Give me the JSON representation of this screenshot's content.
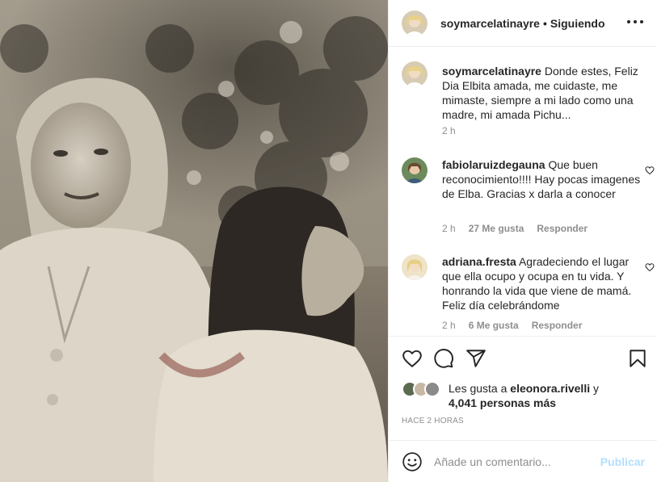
{
  "post": {
    "image_alt": "Fotografía antigua en blanco y negro de una mujer y una niña",
    "header": {
      "username": "soymarcelatinayre",
      "separator": "•",
      "follow_status": "Siguiendo",
      "more_icon": "more-horizontal-icon"
    },
    "caption": {
      "username": "soymarcelatinayre",
      "text": "Donde estes, Feliz Dia Elbita amada, me cuidaste, me mimaste, siempre a mi lado como una madre, mi amada Pichu...",
      "time": "2 h"
    },
    "comments": [
      {
        "username": "fabiolaruizdegauna",
        "text": "Que buen reconocimiento!!!! Hay pocas imagenes de Elba. Gracias x darla a conocer",
        "time": "2 h",
        "likes": "27 Me gusta",
        "reply": "Responder"
      },
      {
        "username": "adriana.fresta",
        "text": "Agradeciendo el lugar que ella ocupo y ocupa en tu vida. Y honrando la vida que viene de mamá. Feliz día celebrándome",
        "time": "2 h",
        "likes": "6 Me gusta",
        "reply": "Responder"
      }
    ],
    "likes": {
      "prefix": "Les gusta a",
      "user": "eleonora.rivelli",
      "conj": "y",
      "others": "4,041 personas más"
    },
    "timestamp": "HACE 2 HORAS",
    "add_comment": {
      "placeholder": "Añade un comentario...",
      "publish_label": "Publicar"
    }
  },
  "colors": {
    "text": "#262626",
    "muted": "#8e8e8e",
    "publish_disabled": "#b2dffc",
    "border": "#efefef"
  },
  "icons": [
    "heart-icon",
    "comment-icon",
    "share-icon",
    "bookmark-icon",
    "emoji-icon",
    "more-horizontal-icon"
  ]
}
